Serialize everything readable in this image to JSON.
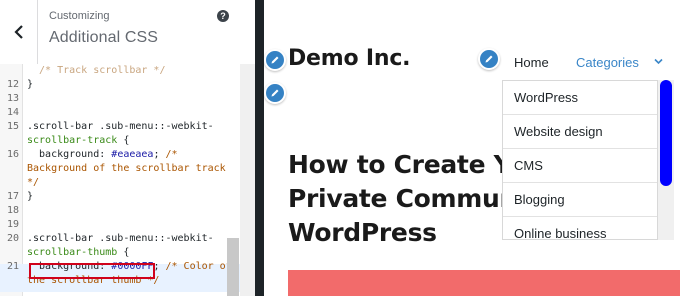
{
  "sidebar": {
    "header": {
      "back_icon": "chevron-left-icon",
      "customizing_label": "Customizing",
      "panel_title": "Additional CSS",
      "help_icon": "question-mark-icon",
      "help_glyph": "?"
    },
    "code_lines": [
      {
        "num": "",
        "tokens": [
          {
            "text": "  /* Track scrollbar */",
            "type": "fade"
          }
        ]
      },
      {
        "num": "12",
        "tokens": [
          {
            "text": "}",
            "type": "sel"
          }
        ]
      },
      {
        "num": "13",
        "tokens": []
      },
      {
        "num": "14",
        "tokens": []
      },
      {
        "num": "15",
        "tokens": [
          {
            "text": ".scroll-bar .sub-menu::-webkit-",
            "type": "sel"
          }
        ]
      },
      {
        "num": "",
        "tokens": [
          {
            "text": "scrollbar-track",
            "type": "prop"
          },
          {
            "text": " {",
            "type": "sel"
          }
        ]
      },
      {
        "num": "16",
        "tokens": [
          {
            "text": "  background: ",
            "type": "sel"
          },
          {
            "text": "#eaeaea",
            "type": "val"
          },
          {
            "text": "; ",
            "type": "sel"
          },
          {
            "text": "/*",
            "type": "cmt"
          }
        ]
      },
      {
        "num": "",
        "tokens": [
          {
            "text": "Background of the scrollbar track",
            "type": "cmt"
          }
        ]
      },
      {
        "num": "",
        "tokens": [
          {
            "text": "*/",
            "type": "cmt"
          }
        ]
      },
      {
        "num": "17",
        "tokens": [
          {
            "text": "}",
            "type": "sel"
          }
        ]
      },
      {
        "num": "18",
        "tokens": []
      },
      {
        "num": "19",
        "tokens": []
      },
      {
        "num": "20",
        "tokens": [
          {
            "text": ".scroll-bar .sub-menu::-webkit-",
            "type": "sel"
          }
        ]
      },
      {
        "num": "",
        "tokens": [
          {
            "text": "scrollbar-thumb",
            "type": "prop"
          },
          {
            "text": " {",
            "type": "sel"
          }
        ]
      },
      {
        "num": "21",
        "tokens": [
          {
            "text": "  background: ",
            "type": "sel"
          },
          {
            "text": "#0000FF",
            "type": "val"
          },
          {
            "text": "; ",
            "type": "sel"
          },
          {
            "text": "/* Color of",
            "type": "cmt"
          }
        ]
      },
      {
        "num": "",
        "tokens": [
          {
            "text": "the scrollbar thumb */",
            "type": "cmt"
          }
        ]
      }
    ]
  },
  "preview": {
    "site_title": "Demo Inc.",
    "edit_icon": "pencil-icon",
    "nav": {
      "home": "Home",
      "categories": "Categories",
      "chevron_icon": "chevron-down-icon"
    },
    "dropdown_items": [
      "WordPress",
      "Website design",
      "CMS",
      "Blogging",
      "Online business"
    ],
    "post_title_lines": [
      "How to Create Y",
      "Private Commun",
      "WordPress"
    ],
    "colors": {
      "scrollbar_thumb": "#0000FF",
      "scrollbar_track": "#eaeaea",
      "hero_strip": "#f26b6b",
      "link": "#3a86c8",
      "edit_shortcut": "#3582c4"
    }
  }
}
